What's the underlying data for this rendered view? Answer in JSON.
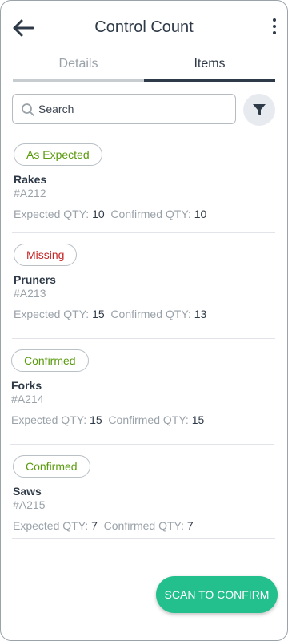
{
  "header": {
    "title": "Control Count",
    "back_icon": "arrow-left-icon",
    "menu_icon": "more-vertical-icon"
  },
  "tabs": [
    {
      "label": "Details",
      "active": false
    },
    {
      "label": "Items",
      "active": true
    }
  ],
  "search": {
    "placeholder": "Search",
    "value": ""
  },
  "colors": {
    "accent": "#23bf8c",
    "status_green": "#5a9a0e",
    "status_red": "#c62828",
    "text_dark": "#2f3a48",
    "text_muted": "#9aa2a9",
    "filter_bg": "#e7ebf0"
  },
  "items": [
    {
      "status": "As Expected",
      "status_color": "#5a9a0e",
      "name": "Rakes",
      "sku": "#A212",
      "expected_label": "Expected QTY:",
      "expected_qty": "10",
      "confirmed_label": "Confirmed QTY:",
      "confirmed_qty": "10"
    },
    {
      "status": "Missing",
      "status_color": "#c62828",
      "name": "Pruners",
      "sku": "#A213",
      "expected_label": "Expected QTY:",
      "expected_qty": "15",
      "confirmed_label": "Confirmed QTY:",
      "confirmed_qty": "13"
    },
    {
      "status": "Confirmed",
      "status_color": "#5a9a0e",
      "name": "Forks",
      "sku": "#A214",
      "expected_label": "Expected QTY:",
      "expected_qty": "15",
      "confirmed_label": "Confirmed QTY:",
      "confirmed_qty": "15"
    },
    {
      "status": "Confirmed",
      "status_color": "#5a9a0e",
      "name": "Saws",
      "sku": "#A215",
      "expected_label": "Expected QTY:",
      "expected_qty": "7",
      "confirmed_label": "Confirmed QTY:",
      "confirmed_qty": "7"
    }
  ],
  "fab": {
    "label": "SCAN TO CONFIRM"
  }
}
